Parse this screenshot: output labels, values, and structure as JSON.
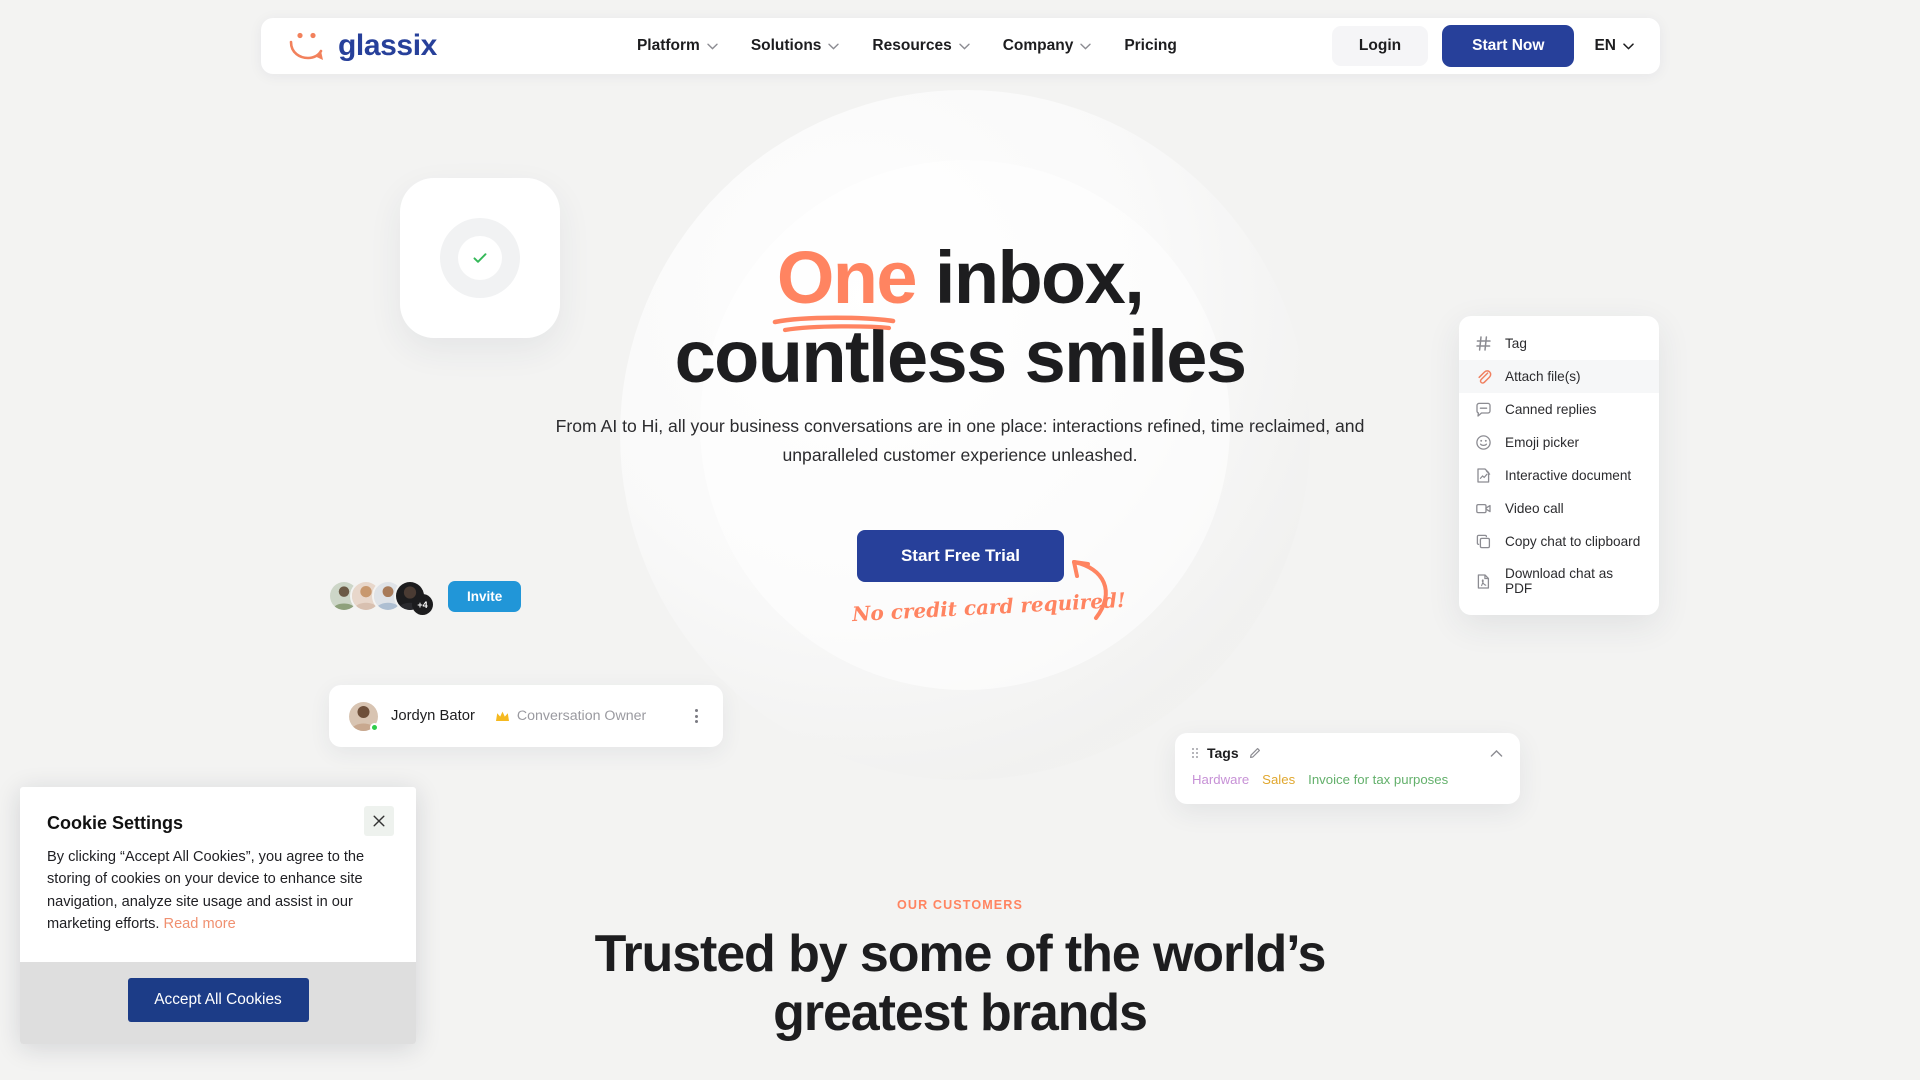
{
  "header": {
    "logo_text": "glassix",
    "nav": [
      {
        "label": "Platform",
        "has_dropdown": true
      },
      {
        "label": "Solutions",
        "has_dropdown": true
      },
      {
        "label": "Resources",
        "has_dropdown": true
      },
      {
        "label": "Company",
        "has_dropdown": true
      },
      {
        "label": "Pricing",
        "has_dropdown": false
      }
    ],
    "login_label": "Login",
    "start_now_label": "Start Now",
    "language": "EN"
  },
  "hero": {
    "headline_highlight": "One",
    "headline_rest": " inbox,",
    "headline_line2": "countless smiles",
    "subtitle": "From AI to Hi, all your business conversations are in one place: interactions refined, time reclaimed, and unparalleled customer experience unleashed.",
    "cta_label": "Start Free Trial",
    "no_card_note": "No credit card required!"
  },
  "avatars": {
    "overflow_badge": "+4",
    "invite_label": "Invite"
  },
  "owner_card": {
    "name": "Jordyn Bator",
    "role": "Conversation Owner"
  },
  "side_menu": {
    "items": [
      {
        "label": "Tag",
        "icon": "hash-icon",
        "active": false
      },
      {
        "label": "Attach file(s)",
        "icon": "paperclip-icon",
        "active": true
      },
      {
        "label": "Canned replies",
        "icon": "chat-bubble-icon",
        "active": false
      },
      {
        "label": "Emoji picker",
        "icon": "smiley-icon",
        "active": false
      },
      {
        "label": "Interactive document",
        "icon": "document-edit-icon",
        "active": false
      },
      {
        "label": "Video call",
        "icon": "video-camera-icon",
        "active": false
      },
      {
        "label": "Copy chat to clipboard",
        "icon": "copy-icon",
        "active": false
      },
      {
        "label": "Download chat as PDF",
        "icon": "pdf-file-icon",
        "active": false
      }
    ]
  },
  "tags_panel": {
    "title": "Tags",
    "tags": [
      {
        "label": "Hardware",
        "color": "#c791d6"
      },
      {
        "label": "Sales",
        "color": "#e0a72e"
      },
      {
        "label": "Invoice for tax purposes",
        "color": "#63b06b"
      }
    ]
  },
  "customers": {
    "eyebrow": "OUR CUSTOMERS",
    "title_line1": "Trusted by some of the world’s",
    "title_line2": "greatest brands"
  },
  "cookie": {
    "title": "Cookie Settings",
    "text": "By clicking “Accept All Cookies”, you agree to the storing of cookies on your device to enhance site navigation, analyze site usage and assist in our marketing efforts. ",
    "link_label": "Read more",
    "accept_label": "Accept All Cookies"
  },
  "colors": {
    "brand_navy": "#27409a",
    "accent_coral": "#ff8461",
    "invite_blue": "#2196d8",
    "page_bg": "#f3f3f2"
  }
}
